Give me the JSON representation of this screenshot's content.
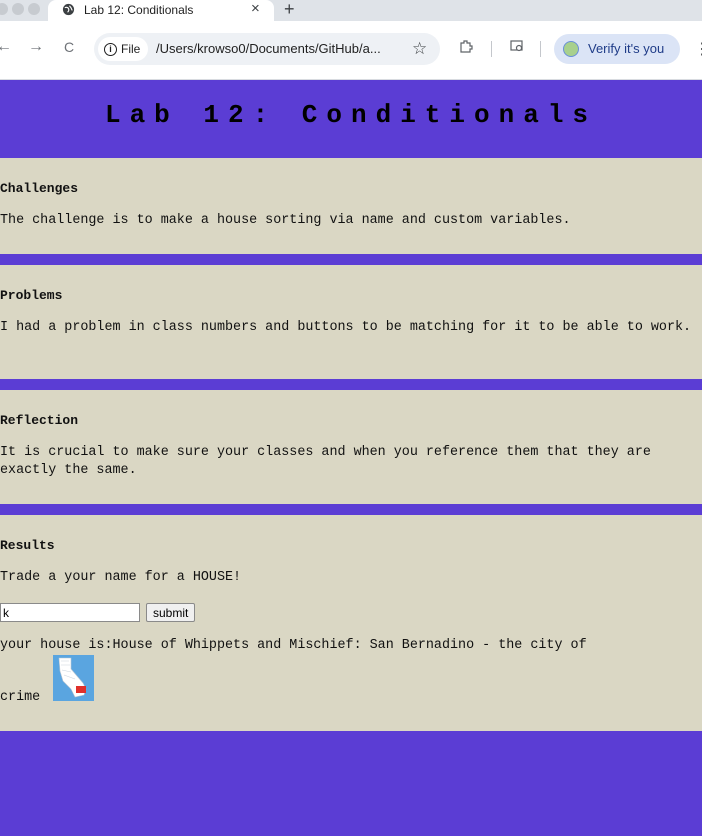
{
  "browser": {
    "tab_title": "Lab 12: Conditionals",
    "tab_close": "×",
    "new_tab": "+",
    "back": "←",
    "forward": "→",
    "reload": "C",
    "info_chip": "File",
    "url": "/Users/krowso0/Documents/GitHub/a...",
    "star": "☆",
    "verify_label": "Verify it's you",
    "menu": "⋮"
  },
  "page": {
    "title": "Lab 12: Conditionals",
    "sections": [
      {
        "heading": "Challenges",
        "body": "The challenge is to make a house sorting via name and custom variables."
      },
      {
        "heading": "Problems",
        "body": "I had a problem in class numbers and buttons to be matching for it to be able to work."
      },
      {
        "heading": "Reflection",
        "body": "It is crucial to make sure your classes and when you reference them that they are exactly the same."
      }
    ],
    "results": {
      "heading": "Results",
      "prompt": "Trade a your name for a HOUSE!",
      "input_value": "k",
      "submit_label": "submit",
      "output_text": "your house is:House of Whippets and Mischief: San Bernadino - the city of",
      "output_cont": "crime"
    }
  },
  "colors": {
    "background": "#5b3dd4",
    "section": "#dad7c4"
  }
}
